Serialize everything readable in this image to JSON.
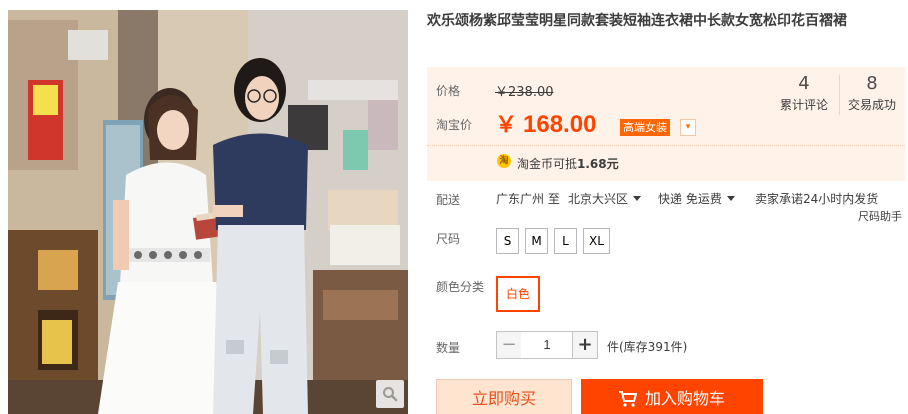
{
  "product": {
    "title": "欢乐颂杨紫邱莹莹明星同款套装短袖连衣裙中长款女宽松印花百褶裙"
  },
  "price": {
    "label": "价格",
    "original": "￥238.00",
    "taobao_label": "淘宝价",
    "currency": "￥",
    "current": "168.00",
    "promo_tag": "高端女装",
    "stats": [
      {
        "num": "4",
        "caption": "累计评论"
      },
      {
        "num": "8",
        "caption": "交易成功"
      }
    ],
    "coin_icon": "淘",
    "coin_prefix": "淘金币可抵",
    "coin_amount": "1.68元"
  },
  "shipping": {
    "label": "配送",
    "from_to": "广东广州 至",
    "destination": "北京大兴区",
    "method": "快递 免运费",
    "promise": "卖家承诺24小时内发货"
  },
  "size": {
    "label": "尺码",
    "helper": "尺码助手",
    "options": [
      "S",
      "M",
      "L",
      "XL"
    ]
  },
  "color": {
    "label": "颜色分类",
    "selected": "白色"
  },
  "quantity": {
    "label": "数量",
    "minus": "−",
    "value": "1",
    "plus": "+",
    "stock": "件(库存391件)"
  },
  "actions": {
    "buy_now": "立即购买",
    "add_to_cart": "加入购物车"
  },
  "icons": {
    "zoom": "magnifier-icon",
    "cart": "cart-icon",
    "coin": "coin-icon"
  },
  "colors": {
    "accent": "#ff4400",
    "price_bg": "#fff2e8",
    "promo": "#ff6600"
  }
}
